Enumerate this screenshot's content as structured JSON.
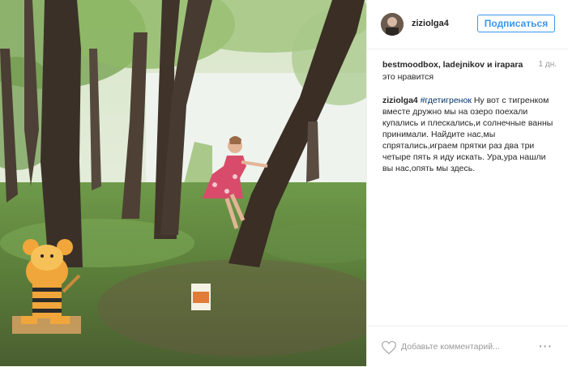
{
  "post": {
    "photo_alt": "photo",
    "username": "ziziolga4",
    "follow_label": "Подписаться",
    "likes": {
      "names": "bestmoodbox, ladejnikov и irapara",
      "suffix": "это нравится",
      "time": "1 дн."
    },
    "caption": {
      "username": "ziziolga4",
      "hashtag": "#гдетигренок",
      "text": " Ну вот с тигренком вместе дружно мы на озеро поехали купались и плескались,и солнечные ванны принимали. Найдите нас,мы спрятались,играем прятки раз два три четыре пять я иду искать. Ура,ура нашли вы нас,опять мы здесь."
    },
    "comment_placeholder": "Добавьте комментарий...",
    "more_label": "···"
  },
  "colors": {
    "accent": "#3897f0",
    "hashtag": "#003569",
    "muted": "#999999"
  },
  "icons": {
    "like": "heart-icon",
    "more": "more-options-icon"
  }
}
